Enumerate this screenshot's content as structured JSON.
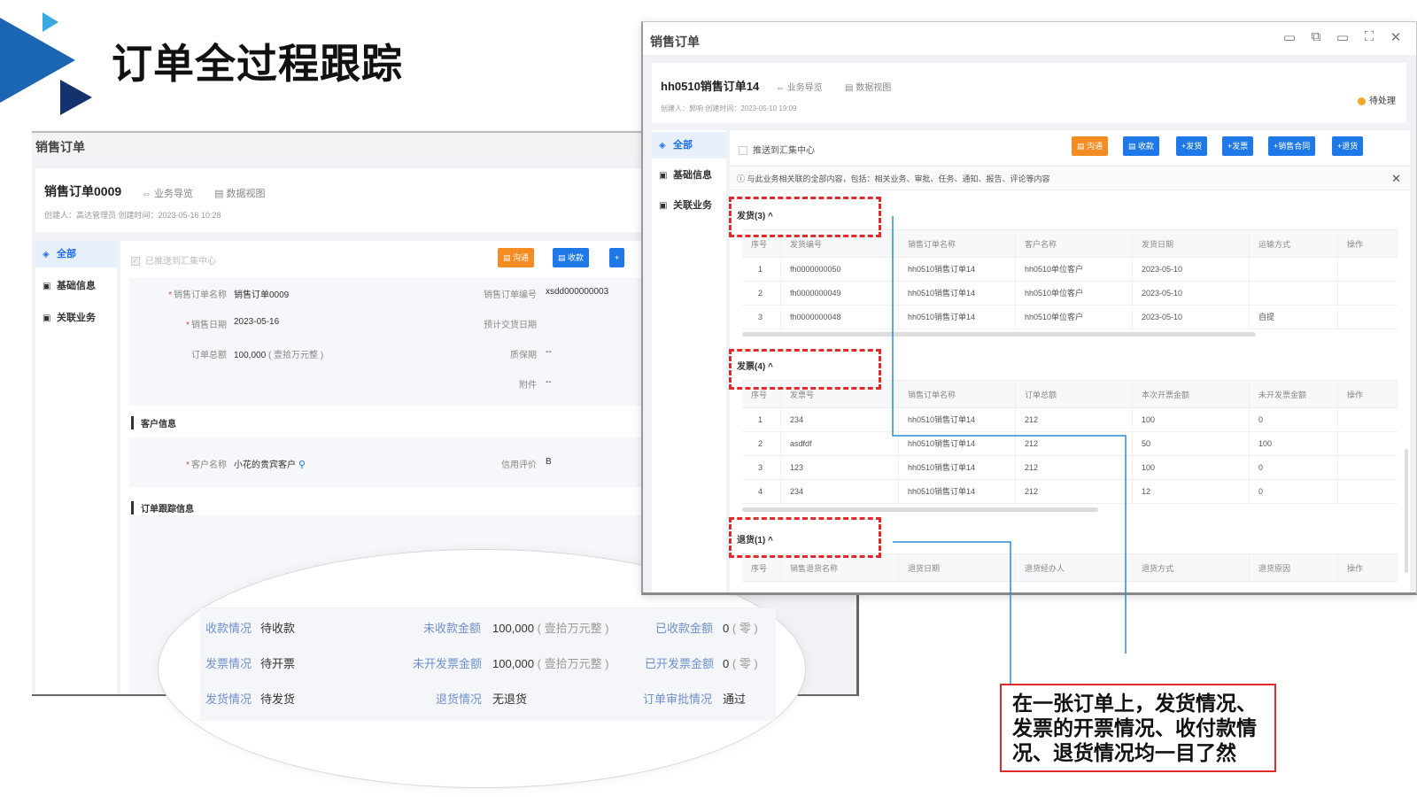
{
  "slide": {
    "title": "订单全过程跟踪"
  },
  "left_window": {
    "header": "销售订单",
    "order_title": "销售订单0009",
    "tab_flow": "业务导览",
    "tab_data_view": "数据视图",
    "meta": "创建人：高达管理员   创建时间：2023-05-16 10:28",
    "nav": [
      "全部",
      "基础信息",
      "关联业务"
    ],
    "push_label": "已推送到汇集中心",
    "btn_communicate": "沟通",
    "btn_receipt": "收款",
    "btn_more": "+",
    "form": {
      "order_name_label": "销售订单名称",
      "order_name": "销售订单0009",
      "order_no_label": "销售订单编号",
      "order_no": "xsdd000000003",
      "sale_date_label": "销售日期",
      "sale_date": "2023-05-16",
      "delivery_date_label": "预计交货日期",
      "total_label": "订单总额",
      "total": "100,000",
      "total_words": "( 壹拾万元整 )",
      "warranty_label": "质保期",
      "warranty": "--",
      "attach_label": "附件",
      "attach": "--"
    },
    "customer_section": "客户信息",
    "customer_name_label": "客户名称",
    "customer_name": "小花的贵宾客户",
    "credit_label": "信用评价",
    "credit": "B",
    "tracking_section": "订单跟踪信息"
  },
  "zoom": {
    "r1": [
      "收款情况",
      "待收款",
      "未收款金额",
      "100,000",
      "( 壹拾万元整 )",
      "已收款金额",
      "0",
      "( 零 )"
    ],
    "r2": [
      "发票情况",
      "待开票",
      "未开发票金额",
      "100,000",
      "( 壹拾万元整 )",
      "已开发票金额",
      "0",
      "( 零 )"
    ],
    "r3": [
      "发货情况",
      "待发货",
      "退货情况",
      "无退货",
      "订单审批情况",
      "通过"
    ]
  },
  "right_window": {
    "header": "销售订单",
    "order_title": "hh0510销售订单14",
    "tab_flow": "业务导览",
    "tab_data_view": "数据视图",
    "meta": "创建人：郭响   创建时间：2023-05-10 19:09",
    "status": "待处理",
    "nav": [
      "全部",
      "基础信息",
      "关联业务"
    ],
    "push_label": "推送到汇集中心",
    "buttons": [
      "沟通",
      "收款",
      "+发货",
      "+发票",
      "+销售合同",
      "+退货"
    ],
    "notice": "与此业务相关联的全部内容，包括：相关业务、审批、任务、通知、报告、评论等内容",
    "shipping": {
      "title": "发货(3)",
      "headers": [
        "序号",
        "发货编号",
        "销售订单名称",
        "客户名称",
        "发货日期",
        "运输方式",
        "操作"
      ],
      "rows": [
        [
          "1",
          "fh0000000050",
          "hh0510销售订单14",
          "hh0510单位客户",
          "2023-05-10",
          ""
        ],
        [
          "2",
          "fh0000000049",
          "hh0510销售订单14",
          "hh0510单位客户",
          "2023-05-10",
          ""
        ],
        [
          "3",
          "fh0000000048",
          "hh0510销售订单14",
          "hh0510单位客户",
          "2023-05-10",
          "自提"
        ]
      ]
    },
    "invoice": {
      "title": "发票(4)",
      "headers": [
        "序号",
        "发票号",
        "销售订单名称",
        "订单总额",
        "本次开票金额",
        "未开发票金额",
        "操作"
      ],
      "rows": [
        [
          "1",
          "234",
          "hh0510销售订单14",
          "212",
          "100",
          "0"
        ],
        [
          "2",
          "asdfdf",
          "hh0510销售订单14",
          "212",
          "50",
          "100"
        ],
        [
          "3",
          "123",
          "hh0510销售订单14",
          "212",
          "100",
          "0"
        ],
        [
          "4",
          "234",
          "hh0510销售订单14",
          "212",
          "12",
          "0"
        ]
      ]
    },
    "returns": {
      "title": "退货(1)",
      "headers": [
        "序号",
        "销售退货名称",
        "退货日期",
        "退货经办人",
        "退货方式",
        "退货原因",
        "操作"
      ]
    }
  },
  "callout": {
    "text": "在一张订单上，发货情况、发票的开票情况、收付款情况、退货情况均一目了然"
  }
}
